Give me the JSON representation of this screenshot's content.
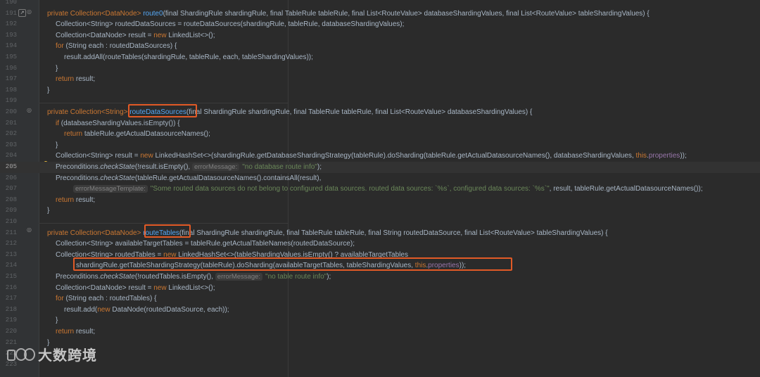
{
  "editor": {
    "line_numbers": [
      "190",
      "191",
      "192",
      "193",
      "194",
      "195",
      "196",
      "197",
      "198",
      "199",
      "200",
      "201",
      "202",
      "203",
      "204",
      "205",
      "206",
      "207",
      "208",
      "209",
      "210",
      "211",
      "212",
      "213",
      "214",
      "215",
      "216",
      "217",
      "218",
      "219",
      "220",
      "221",
      "222",
      "223"
    ],
    "current_line": "205",
    "code": {
      "route0": {
        "p1": "private Collection<DataNode> ",
        "name": "route0",
        "p2": "(final ShardingRule shardingRule, final TableRule tableRule, final List<RouteValue> databaseShardingValues, final List<RouteValue> tableShardingValues) {"
      },
      "l192": "Collection<String> routedDataSources = routeDataSources(shardingRule, tableRule, databaseShardingValues);",
      "l193a": "Collection<DataNode> result = ",
      "l193b": "new",
      "l193c": " LinkedList<>();",
      "l194a": "for",
      "l194b": " (String each : routedDataSources) {",
      "l195": "result.addAll(routeTables(shardingRule, tableRule, each, tableShardingValues));",
      "close": "}",
      "ret_kw": "return",
      "ret_result": " result;",
      "rds": {
        "p1": "private Collection<String> ",
        "name": "routeDataSources",
        "p2": "(final ShardingRule shardingRule, final TableRule tableRule, final List<RouteValue> databaseShardingValues) {"
      },
      "l201a": "if",
      "l201b": " (databaseShardingValues.isEmpty()) {",
      "l202": " tableRule.getActualDatasourceNames();",
      "l204a": "Collection<String> result = ",
      "l204b": "new",
      "l204c": " LinkedHashSet<>(shardingRule.getDatabaseShardingStrategy(tableRule).doSharding(tableRule.getActualDatasourceNames(), databaseShardingValues, ",
      "this_kw": "this",
      "properties": "properties",
      "l204d": "));",
      "precond": "Preconditions.",
      "checkState": "checkState",
      "l205a": "(!result.isEmpty(), ",
      "hint_errorMessage": "errorMessage:",
      "l205str": "\"no database route info\"",
      "l205end": ");",
      "l206": "(tableRule.getActualDatasourceNames().containsAll(result),",
      "hint_errorMessageTemplate": "errorMessageTemplate:",
      "l207str": "\"Some routed data sources do not belong to configured data sources. routed data sources: `%s`, configured data sources: `%s`\"",
      "l207end": ", result, tableRule.getActualDatasourceNames());",
      "rt": {
        "p1": "private Collection<DataNode> ",
        "name": "routeTables",
        "p2": "(final ShardingRule shardingRule, final TableRule tableRule, final String routedDataSource, final List<RouteValue> tableShardingValues) {"
      },
      "l212": "Collection<String> availableTargetTables = tableRule.getActualTableNames(routedDataSource);",
      "l213a": "Collection<String> routedTables = ",
      "l213b": "new",
      "l213c": " LinkedHashSet<>(tableShardingValues.isEmpty() ? availableTargetTables",
      "l214a": "shardingRule.getTableShardingStrategy(tableRule).doSharding(availableTargetTables, tableShardingValues, ",
      "l215a": "(!routedTables.isEmpty(), ",
      "l215str": "\"no table route info\"",
      "l217a": "Collection<DataNode> result = ",
      "l218b": " (String each : routedTables) {",
      "l219a": "result.add(",
      "l219b": " DataNode(routedDataSource, each));",
      "dot": "."
    }
  },
  "watermark": {
    "text": "大数跨境"
  }
}
